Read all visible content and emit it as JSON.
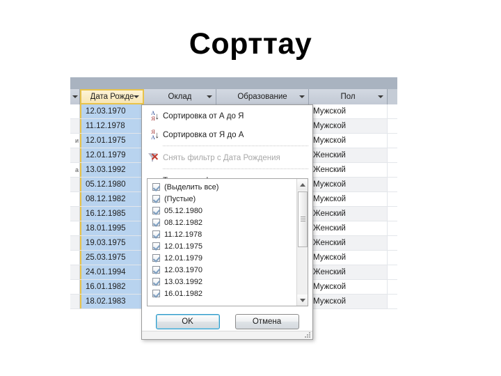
{
  "slide": {
    "title": "Сорттау"
  },
  "datasheet": {
    "columns": [
      {
        "key": "stub",
        "label": ""
      },
      {
        "key": "date",
        "label": "Дата Рожде",
        "selected": true
      },
      {
        "key": "salary",
        "label": "Оклад"
      },
      {
        "key": "edu",
        "label": "Образование"
      },
      {
        "key": "sex",
        "label": "Пол"
      }
    ],
    "rows": [
      {
        "stub": "",
        "date": "12.03.1970",
        "salary": "",
        "edu": "",
        "sex": "Мужской"
      },
      {
        "stub": "",
        "date": "11.12.1978",
        "salary": "",
        "edu": "",
        "sex": "Мужской"
      },
      {
        "stub": "и",
        "date": "12.01.1975",
        "salary": "",
        "edu": "",
        "sex": "Мужской"
      },
      {
        "stub": "",
        "date": "12.01.1979",
        "salary": "",
        "edu": "",
        "sex": "Женский"
      },
      {
        "stub": "а",
        "date": "13.03.1992",
        "salary": "",
        "edu": "",
        "sex": "Женский"
      },
      {
        "stub": "",
        "date": "05.12.1980",
        "salary": "",
        "edu": "",
        "sex": "Мужской"
      },
      {
        "stub": "",
        "date": "08.12.1982",
        "salary": "",
        "edu": "",
        "sex": "Мужской"
      },
      {
        "stub": "",
        "date": "16.12.1985",
        "salary": "",
        "edu": "",
        "sex": "Женский"
      },
      {
        "stub": "",
        "date": "18.01.1995",
        "salary": "",
        "edu": "",
        "sex": "Женский"
      },
      {
        "stub": "",
        "date": "19.03.1975",
        "salary": "",
        "edu": "",
        "sex": "Женский"
      },
      {
        "stub": "",
        "date": "25.03.1975",
        "salary": "",
        "edu": "",
        "sex": "Мужской"
      },
      {
        "stub": "",
        "date": "24.01.1994",
        "salary": "",
        "edu": "",
        "sex": "Женский"
      },
      {
        "stub": "",
        "date": "16.01.1982",
        "salary": "",
        "edu": "",
        "sex": "Мужской"
      },
      {
        "stub": "",
        "date": "18.02.1983",
        "salary": "",
        "edu": "",
        "sex": "Мужской"
      }
    ]
  },
  "filter_panel": {
    "menu": [
      {
        "id": "sort-asc",
        "label": "Сортировка от А до Я",
        "icon": "sort-az-icon",
        "disabled": false
      },
      {
        "id": "sort-desc",
        "label": "Сортировка от Я до А",
        "icon": "sort-za-icon",
        "disabled": false
      },
      {
        "id": "clear-filter",
        "label": "Снять фильтр с Дата Рождения",
        "icon": "clear-filter-icon",
        "disabled": true
      },
      {
        "id": "text-filters",
        "label": "Текстовые фильтры",
        "icon": "none",
        "disabled": false,
        "submenu": true
      }
    ],
    "values": [
      {
        "label": "(Выделить все)",
        "checked": true
      },
      {
        "label": "(Пустые)",
        "checked": true
      },
      {
        "label": "05.12.1980",
        "checked": true
      },
      {
        "label": "08.12.1982",
        "checked": true
      },
      {
        "label": "11.12.1978",
        "checked": true
      },
      {
        "label": "12.01.1975",
        "checked": true
      },
      {
        "label": "12.01.1979",
        "checked": true
      },
      {
        "label": "12.03.1970",
        "checked": true
      },
      {
        "label": "13.03.1992",
        "checked": true
      },
      {
        "label": "16.01.1982",
        "checked": true
      }
    ],
    "buttons": {
      "ok": "OK",
      "cancel": "Отмена"
    }
  },
  "colors": {
    "header_band": "#a9b3c0",
    "header_cell": "#c5ccd6",
    "selected_column": "#b8d3ef",
    "selected_border": "#e8c349",
    "row_alt": "#f1f2f4",
    "default_button_border": "#2f99c8"
  }
}
